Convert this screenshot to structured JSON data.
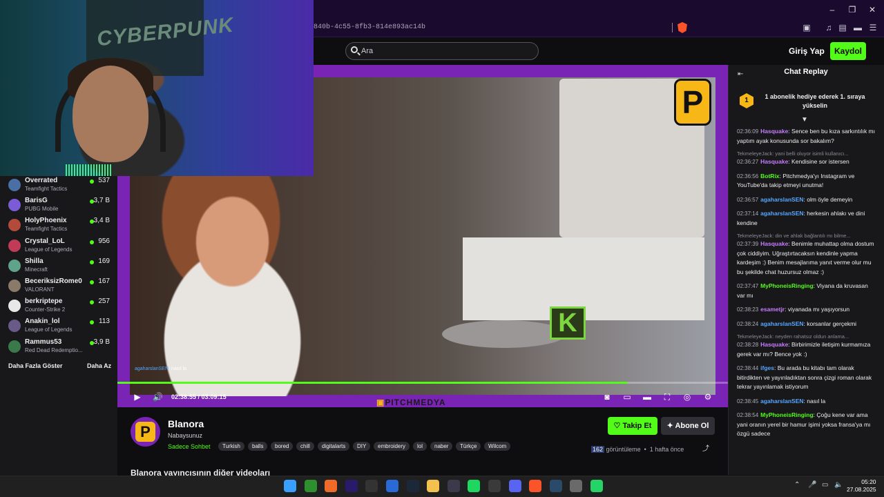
{
  "browser": {
    "url_fragment": "840b-4c55-8fb3-814e893ac14b"
  },
  "site": {
    "search_placeholder": "Ara",
    "login_label": "Giriş Yap",
    "signup_label": "Kaydol"
  },
  "sidebar": {
    "channels": [
      {
        "name": "Overrated",
        "game": "Teamfight Tactics",
        "viewers": "537",
        "color": "#4a6fa5"
      },
      {
        "name": "BarisG",
        "game": "PUBG Mobile",
        "viewers": "3,7 B",
        "color": "#7b5bd6"
      },
      {
        "name": "HolyPhoenix",
        "game": "Teamfight Tactics",
        "viewers": "3,4 B",
        "color": "#b44a3a"
      },
      {
        "name": "Crystal_LoL",
        "game": "League of Legends",
        "viewers": "956",
        "color": "#c23b56"
      },
      {
        "name": "Shilla",
        "game": "Minecraft",
        "viewers": "169",
        "color": "#5fa38a"
      },
      {
        "name": "BeceriksizRome0",
        "game": "VALORANT",
        "viewers": "167",
        "color": "#8a7a6a"
      },
      {
        "name": "berkriptepe",
        "game": "Counter-Strike 2",
        "viewers": "257",
        "color": "#e8e8e8"
      },
      {
        "name": "Anakin_lol",
        "game": "League of Legends",
        "viewers": "113",
        "color": "#6a5a8a"
      },
      {
        "name": "Rammus53",
        "game": "Red Dead Redemptio...",
        "viewers": "3,9 B",
        "color": "#3a7a4a"
      }
    ],
    "show_more": "Daha Fazla Göster",
    "show_less": "Daha Az"
  },
  "webcam": {
    "poster_text": "CYBERPUNK"
  },
  "video": {
    "logo_letter": "P",
    "k_letter": "K",
    "overlay_chat_user": "agaharslanSEN",
    "overlay_chat_text": ": nasıl la",
    "current_time": "02:38:55",
    "duration": "03:09:15",
    "progress": 0.836,
    "watermark": "PITCHMEDYA"
  },
  "channel": {
    "name": "Blanora",
    "avatar_letter": "P",
    "title": "Nabaysunuz",
    "chat_mode": "Sadece Sohbet",
    "tags": [
      "Turkish",
      "balls",
      "bored",
      "chill",
      "digitalarts",
      "DIY",
      "embroidery",
      "lol",
      "naber",
      "Türkçe",
      "Wilcom"
    ],
    "follow_label": "Takip Et",
    "subscribe_label": "Abone Ol",
    "view_count": "162",
    "views_label": "görüntüleme",
    "age": "1 hafta önce",
    "other_videos": "Blanora yayıncısının diğer videoları"
  },
  "chat": {
    "title": "Chat Replay",
    "pinned_rank": "1",
    "pinned_text": "1 abonelik hediye ederek 1. sıraya yükselin",
    "messages": [
      {
        "ts": "02:36:09",
        "user": "Hasquake",
        "color": "#c77dff",
        "text": "Sence ben bu kıza sarkıntılık mı yaptım ayak konusunda sor bakalım?"
      },
      {
        "reply": "TekmeleyeJack: yani belli oluyor isimli kullanıcı...",
        "ts": "02:36:27",
        "user": "Hasquake",
        "color": "#c77dff",
        "text": "Kendisine sor istersen"
      },
      {
        "ts": "02:36:56",
        "user": "BotRix",
        "color": "#53fc18",
        "text": "Pitchmedya'yı Instagram ve YouTube'da takip etmeyi unutma!"
      },
      {
        "ts": "02:36:57",
        "user": "agaharslanSEN",
        "color": "#57a7ff",
        "text": "olm öyle demeyin"
      },
      {
        "ts": "02:37:14",
        "user": "agaharslanSEN",
        "color": "#57a7ff",
        "text": "herkesin ahlakı ve dini kendine"
      },
      {
        "reply": "TekmeleyeJack: din ve ahlak bağlantılı mı bilme...",
        "ts": "02:37:39",
        "user": "Hasquake",
        "color": "#c77dff",
        "text": "Benimle muhattap olma dostum çok ciddiyim. Uğraştırtacaksın kendinle yapma kardeşim :) Benim mesajlarıma yanıt verme olur mu bu şekilde chat huzursuz olmaz :)"
      },
      {
        "ts": "02:37:47",
        "user": "MyPhoneisRinging",
        "color": "#53fc18",
        "text": "Viyana da kruvasan var mı"
      },
      {
        "ts": "02:38:23",
        "user": "esametjr",
        "color": "#c77dff",
        "text": "viyanada mı yaşıyorsun"
      },
      {
        "ts": "02:38:24",
        "user": "agaharslanSEN",
        "color": "#57a7ff",
        "text": "korsanlar gerçekmi"
      },
      {
        "reply": "TekmeleyeJack: neyden rahatsız oldun anlama...",
        "ts": "02:38:28",
        "user": "Hasquake",
        "color": "#c77dff",
        "text": "Birbirimizle iletişim kurmamıza gerek var mı? Bence yok :)"
      },
      {
        "ts": "02:38:44",
        "user": "ifges",
        "color": "#57a7ff",
        "text": "Bu arada bu kitabı tam olarak bitirdikten ve yayınladıktan sonra çizgi roman olarak tekrar yayınlamak istiyorum"
      },
      {
        "ts": "02:38:45",
        "user": "agaharslanSEN",
        "color": "#57a7ff",
        "text": "nasıl la"
      },
      {
        "ts": "02:38:54",
        "user": "MyPhoneisRinging",
        "color": "#53fc18",
        "text": "Çoğu kene var ama yani oranın yerel bir hamur işimi yoksa fransa'ya mı özgü sadece"
      }
    ]
  },
  "taskbar": {
    "time": "05:20",
    "date": "27.08.2025",
    "icons": [
      {
        "name": "windows-start-icon",
        "color": "#3aa0ff"
      },
      {
        "name": "xbox-icon",
        "color": "#2d8f2d"
      },
      {
        "name": "origin-icon",
        "color": "#f06a2a"
      },
      {
        "name": "premiere-icon",
        "color": "#2a1a6a"
      },
      {
        "name": "epic-games-icon",
        "color": "#333333"
      },
      {
        "name": "remote-desktop-icon",
        "color": "#2a6ad6"
      },
      {
        "name": "steam-icon",
        "color": "#1b2838"
      },
      {
        "name": "file-explorer-icon",
        "color": "#f2c14e"
      },
      {
        "name": "obs-icon",
        "color": "#3a3a4a"
      },
      {
        "name": "spotify-icon",
        "color": "#1ed760"
      },
      {
        "name": "github-icon",
        "color": "#3a3a3a"
      },
      {
        "name": "discord-icon",
        "color": "#5865f2"
      },
      {
        "name": "brave-icon",
        "color": "#fb542b"
      },
      {
        "name": "steam-alt-icon",
        "color": "#2a4a6a"
      },
      {
        "name": "settings-icon",
        "color": "#6a6a6a"
      },
      {
        "name": "whatsapp-icon",
        "color": "#25d366"
      }
    ]
  }
}
